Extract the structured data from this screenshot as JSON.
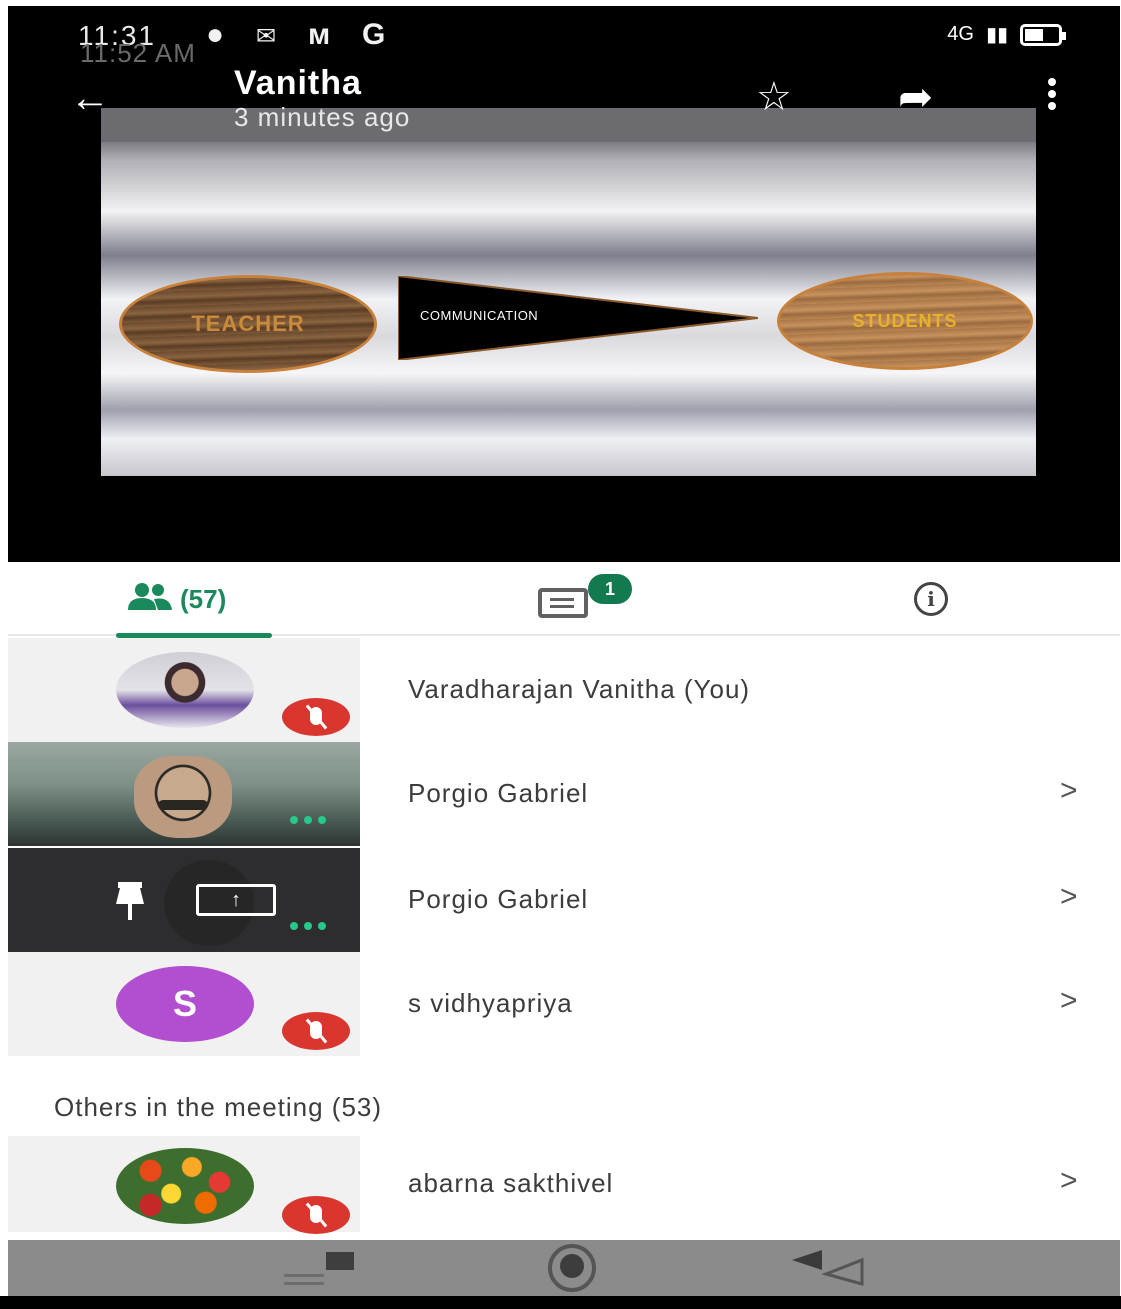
{
  "status_bar": {
    "time": "11:31",
    "time_overlay": "11:52 AM",
    "network": "4G",
    "icons": [
      "whatsapp-icon",
      "gmail-icon",
      "m-icon",
      "google-icon",
      "signal-icon",
      "battery-icon"
    ]
  },
  "app_bar": {
    "title": "Vanitha",
    "subtitle": "3 minutes ago",
    "icons": [
      "back-arrow-icon",
      "star-icon",
      "share-icon",
      "more-vert-icon"
    ]
  },
  "slide": {
    "left_label": "TEACHER",
    "middle_label": "COMMUNICATION",
    "right_label": "STUDENTS"
  },
  "tabs": {
    "people_count": "(57)",
    "chat_badge": "1",
    "info_glyph": "i"
  },
  "participants": [
    {
      "name": "Varadharajan Vanitha (You)",
      "muted": true,
      "has_chevron": false
    },
    {
      "name": "Porgio Gabriel",
      "muted": false,
      "has_chevron": true
    },
    {
      "name": "Porgio Gabriel",
      "muted": false,
      "has_chevron": true,
      "presenting": true
    },
    {
      "name": "s vidhyapriya",
      "initial": "S",
      "muted": true,
      "has_chevron": true
    }
  ],
  "others": {
    "heading": "Others in the meeting (53)",
    "items": [
      {
        "name": "abarna sakthivel",
        "muted": true,
        "has_chevron": true
      }
    ]
  },
  "chevron": ">",
  "colors": {
    "accent_green": "#1a8a5c",
    "badge_green": "#137a4f",
    "mute_red": "#d9362f",
    "avatar_purple": "#b24ed0"
  }
}
